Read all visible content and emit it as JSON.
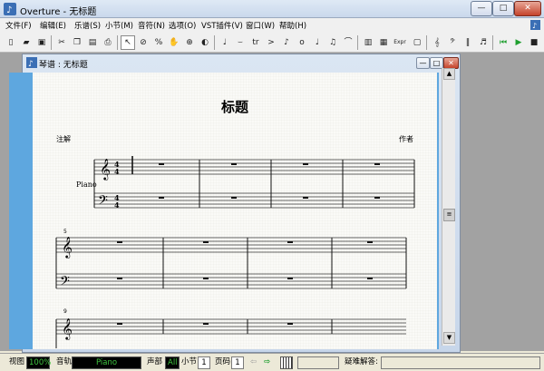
{
  "app": {
    "title": "Overture - 无标题",
    "minimize_glyph": "—",
    "maximize_glyph": "□",
    "close_glyph": "✕"
  },
  "menu": {
    "items": [
      "文件(F)",
      "编辑(E)",
      "乐谱(S)",
      "小节(M)",
      "音符(N)",
      "选项(O)",
      "VST插件(V)",
      "窗口(W)",
      "帮助(H)"
    ]
  },
  "toolbar": {
    "groups": [
      [
        "new-file-icon",
        "open-folder-icon",
        "save-icon"
      ],
      [
        "cut-icon",
        "copy-icon",
        "paste-icon",
        "print-icon"
      ],
      [
        "pointer-icon",
        "prohibit-icon",
        "percent-icon",
        "hand-icon",
        "zoom-icon",
        "speaker-icon"
      ],
      [
        "quarter-note-icon",
        "slur-icon",
        "trill-icon",
        "accent-icon",
        "staccato-icon",
        "dynamic-icon",
        "tie-icon",
        "eighth-note-icon",
        "curve-icon"
      ],
      [
        "keyboard-icon",
        "grid-icon",
        "expression-icon",
        "rect-icon"
      ],
      [
        "treble-clef-icon",
        "bass-clef-icon",
        "bar-line-icon",
        "beam-icon"
      ],
      [
        "rewind-icon",
        "play-from-start-icon",
        "stop-icon",
        "play-icon",
        "record-icon"
      ]
    ],
    "glyphs": {
      "quarter-note-icon": "♩",
      "slur-icon": "⌣",
      "trill-icon": "tr",
      "accent-icon": ">",
      "staccato-icon": "♪",
      "dynamic-icon": "o",
      "tie-icon": "♩",
      "eighth-note-icon": "♫",
      "curve-icon": "⌒",
      "expression-icon": "Expr",
      "treble-clef-icon": "𝄞",
      "bass-clef-icon": "𝄢",
      "rewind-icon": "⏮",
      "play-from-start-icon": "▶",
      "stop-icon": "■",
      "play-icon": "▶",
      "record-icon": "●",
      "percent-icon": "%",
      "prohibit-icon": "⊘",
      "pointer-icon": "↖",
      "hand-icon": "✋",
      "zoom-icon": "⊕",
      "speaker-icon": "◐"
    }
  },
  "document": {
    "window_title": "琴谱 : 无标题",
    "score_title": "标题",
    "notes_label": "注解",
    "composer_label": "作者",
    "instrument": "Piano",
    "measure_numbers": [
      "5",
      "9"
    ],
    "time_signature": {
      "top": "4",
      "bottom": "4"
    }
  },
  "statusbar": {
    "view_label": "视图",
    "zoom_value": "100%",
    "track_label": "音轨",
    "track_value": "Piano",
    "voice_label": "声部",
    "voice_value": "All",
    "measure_label": "小节",
    "measure_value": "1",
    "page_label": "页码",
    "page_value": "1",
    "help_label": "疑难解答:"
  },
  "colors": {
    "play_green": "#1f9f2f",
    "record_red": "#d02020",
    "document_blue": "#5ea7df",
    "status_green": "#3fc43f"
  }
}
